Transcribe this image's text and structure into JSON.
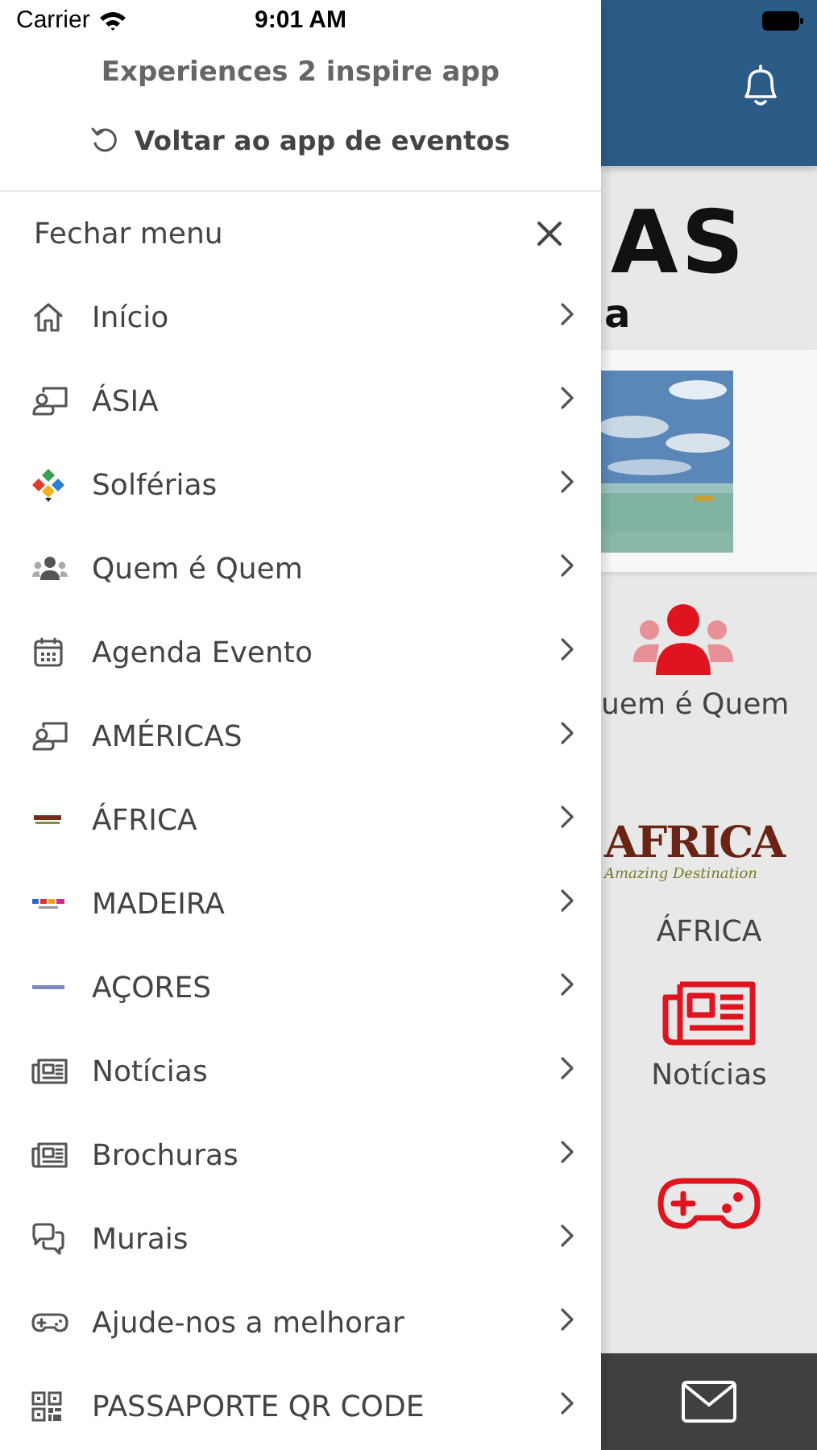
{
  "status_bar": {
    "carrier": "Carrier",
    "time": "9:01 AM"
  },
  "drawer": {
    "app_title": "Experiences 2 inspire app",
    "back_link": "Voltar ao app de eventos",
    "close_label": "Fechar menu",
    "items": [
      {
        "label": "Início"
      },
      {
        "label": "ÁSIA"
      },
      {
        "label": "Solférias"
      },
      {
        "label": "Quem é Quem"
      },
      {
        "label": "Agenda Evento"
      },
      {
        "label": "AMÉRICAS"
      },
      {
        "label": "ÁFRICA"
      },
      {
        "label": "MADEIRA"
      },
      {
        "label": "AÇORES"
      },
      {
        "label": "Notícias"
      },
      {
        "label": "Brochuras"
      },
      {
        "label": "Murais"
      },
      {
        "label": "Ajude-nos a melhorar"
      },
      {
        "label": "PASSAPORTE QR CODE"
      }
    ]
  },
  "background": {
    "heading": "AS",
    "subheading": "a",
    "tiles": [
      {
        "label": "uem é Quem"
      },
      {
        "label": "ÁFRICA"
      },
      {
        "label": "Notícias"
      }
    ],
    "logo": {
      "title": "AFRICA",
      "tagline": "Amazing Destination"
    }
  }
}
